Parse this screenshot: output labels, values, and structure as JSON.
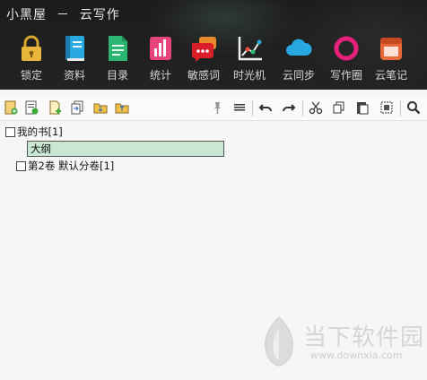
{
  "app": {
    "title": "小黑屋  －  云写作"
  },
  "toolbar": [
    {
      "name": "lock",
      "label": "锁定",
      "icon": "lock-icon",
      "color": "#e8b63a"
    },
    {
      "name": "materials",
      "label": "资料",
      "icon": "book-icon",
      "color": "#27a8e0"
    },
    {
      "name": "outline",
      "label": "目录",
      "icon": "document-icon",
      "color": "#2bb673"
    },
    {
      "name": "stats",
      "label": "统计",
      "icon": "bar-chart-icon",
      "color": "#e8457a"
    },
    {
      "name": "sensitive",
      "label": "敏感词",
      "icon": "chat-bubble-icon",
      "color": "#d91e2a"
    },
    {
      "name": "timemachine",
      "label": "时光机",
      "icon": "chart-line-icon",
      "color": "#f0f0f0"
    },
    {
      "name": "sync",
      "label": "云同步",
      "icon": "cloud-icon",
      "color": "#27a8e0"
    },
    {
      "name": "circle",
      "label": "写作圈",
      "icon": "ring-icon",
      "color": "#e8207a"
    },
    {
      "name": "notes",
      "label": "云笔记",
      "icon": "note-icon",
      "color": "#e86a3a"
    }
  ],
  "tree": {
    "book": {
      "label": "我的书[1]"
    },
    "outline": {
      "label": "大纲"
    },
    "volume": {
      "label": "第2卷 默认分卷[1]"
    }
  },
  "watermark": {
    "cn": "当下软件园",
    "url": "www.downxia.com"
  }
}
